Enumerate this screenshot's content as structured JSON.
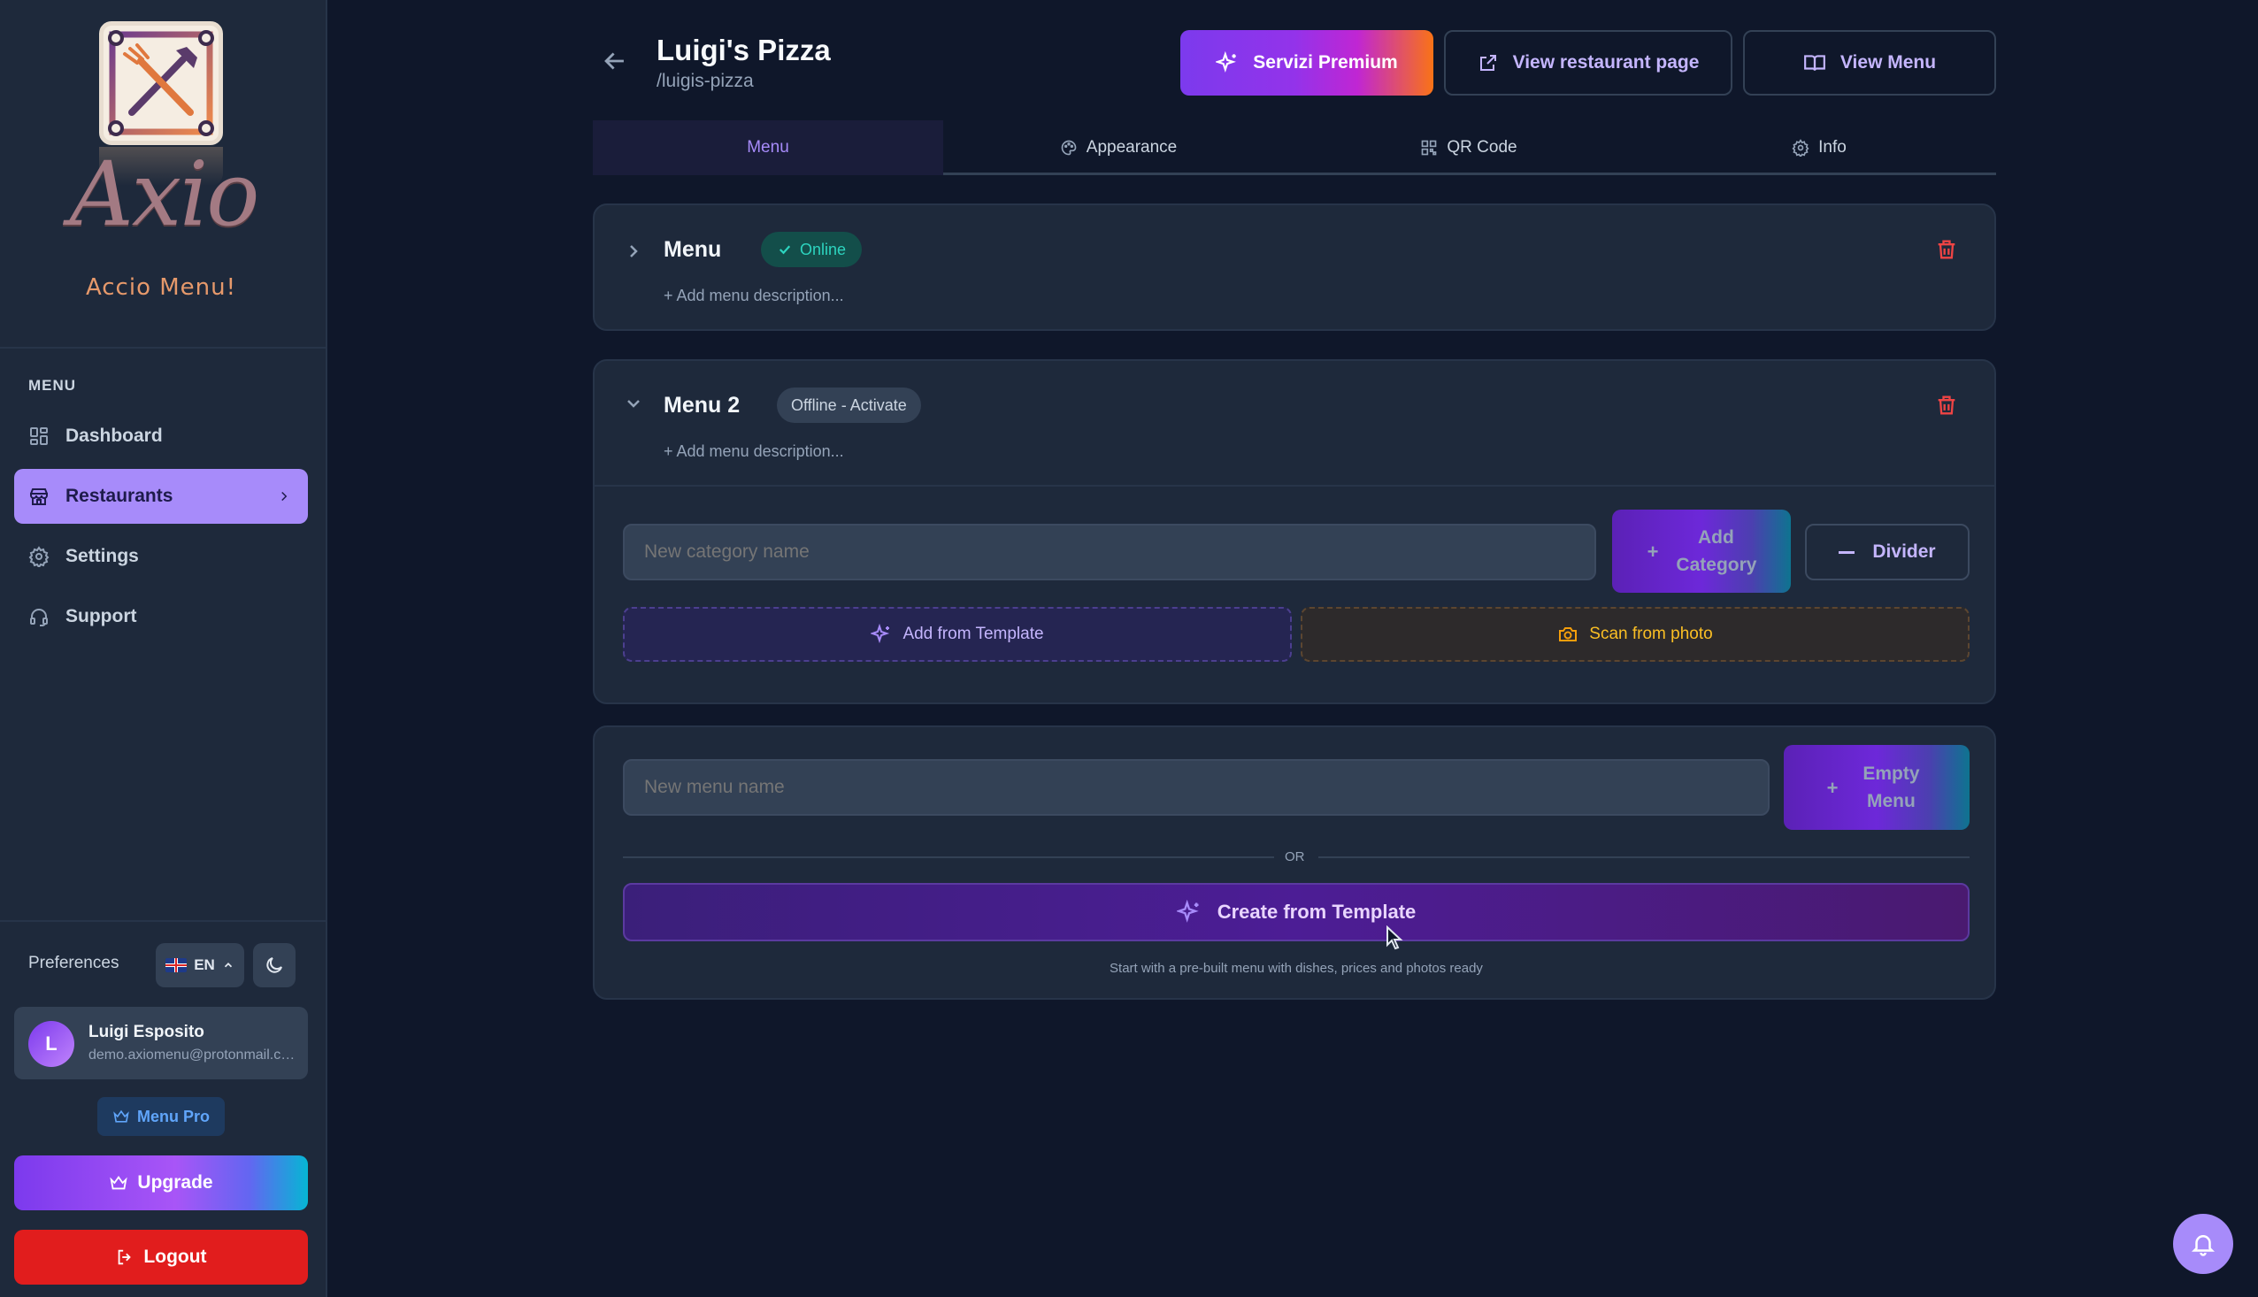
{
  "brand": {
    "name": "Axio",
    "tagline": "Accio Menu!"
  },
  "sidebar": {
    "section_label": "MENU",
    "items": [
      {
        "label": "Dashboard",
        "icon": "dashboard-icon"
      },
      {
        "label": "Restaurants",
        "icon": "store-icon",
        "active": true
      },
      {
        "label": "Settings",
        "icon": "gear-icon"
      },
      {
        "label": "Support",
        "icon": "headset-icon"
      }
    ],
    "preferences_label": "Preferences",
    "language": "EN",
    "user": {
      "initial": "L",
      "name": "Luigi Esposito",
      "email": "demo.axiomenu@protonmail.com"
    },
    "plan_badge": "Menu Pro",
    "upgrade_label": "Upgrade",
    "logout_label": "Logout"
  },
  "header": {
    "title": "Luigi's Pizza",
    "slug": "/luigis-pizza",
    "premium_label": "Servizi Premium",
    "view_page_label": "View restaurant page",
    "view_menu_label": "View Menu"
  },
  "tabs": [
    {
      "label": "Menu",
      "active": true
    },
    {
      "label": "Appearance",
      "icon": "palette-icon"
    },
    {
      "label": "QR Code",
      "icon": "qr-code-icon"
    },
    {
      "label": "Info",
      "icon": "gear-icon"
    }
  ],
  "menus": [
    {
      "name": "Menu",
      "status": "Online",
      "add_description": "+ Add menu description...",
      "expanded": false
    },
    {
      "name": "Menu 2",
      "status": "Offline - Activate",
      "add_description": "+ Add menu description...",
      "expanded": true
    }
  ],
  "category_editor": {
    "placeholder": "New category name",
    "add_category_label": "Add Category",
    "divider_label": "Divider",
    "add_template_label": "Add from Template",
    "scan_photo_label": "Scan from photo"
  },
  "new_menu": {
    "placeholder": "New menu name",
    "empty_menu_label": "Empty Menu",
    "or_text": "OR",
    "create_template_label": "Create from Template",
    "hint": "Start with a pre-built menu with dishes, prices and photos ready"
  },
  "colors": {
    "accent": "#a78bfa",
    "online": "#2dd4bf",
    "danger": "#ef4444",
    "logout": "#e11d1d",
    "scan": "#f59e0b"
  }
}
